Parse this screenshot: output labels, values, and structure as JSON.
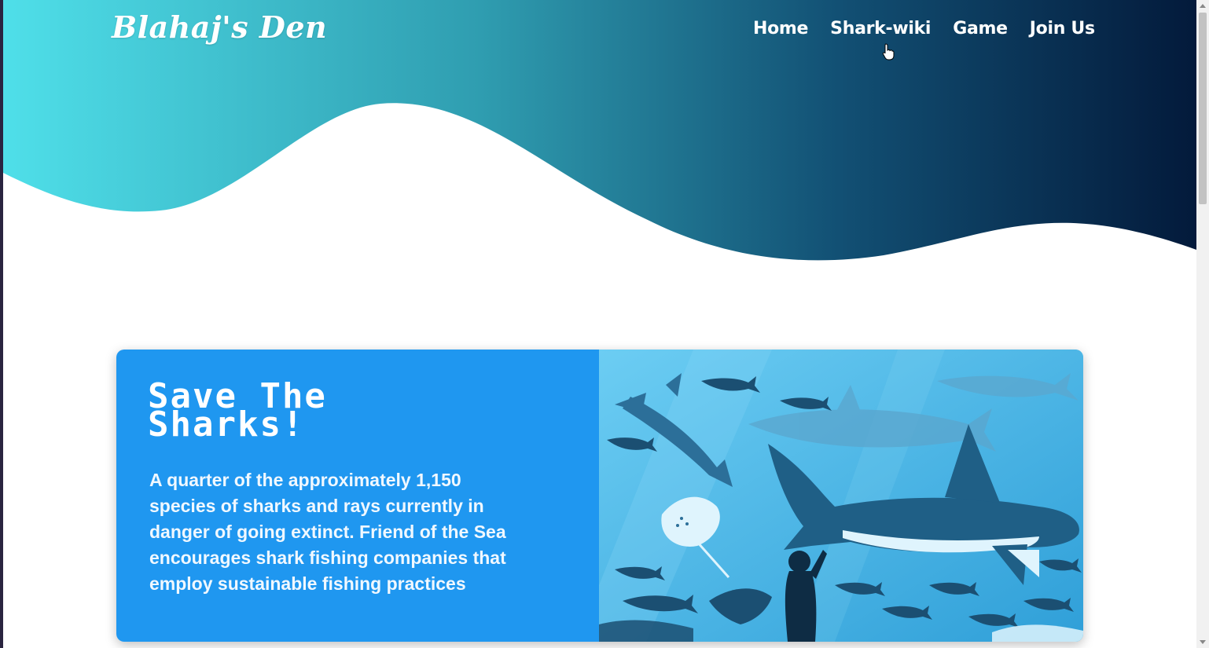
{
  "site": {
    "logo": "Blahaj's Den"
  },
  "nav": {
    "items": [
      {
        "label": "Home"
      },
      {
        "label": "Shark-wiki"
      },
      {
        "label": "Game"
      },
      {
        "label": "Join Us"
      }
    ]
  },
  "feature": {
    "title": "Save The Sharks!",
    "body": "A quarter of the approximately 1,150 species of sharks and rays currently in danger of going extinct. Friend of the Sea encourages shark fishing companies that employ sustainable fishing practices"
  },
  "colors": {
    "hero_start": "#4fdfe9",
    "hero_end": "#031a3b",
    "card_blue": "#1f97f0",
    "illustration_bg": "#43b6e8"
  },
  "icons": {
    "cursor": "hand-pointer-icon",
    "illustration": "sharks-illustration"
  }
}
